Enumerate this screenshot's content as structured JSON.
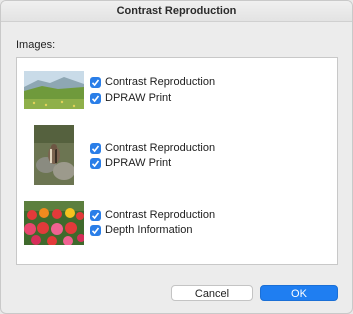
{
  "window": {
    "title": "Contrast Reproduction"
  },
  "images_label": "Images:",
  "images": [
    {
      "thumb_icon": "landscape-meadow-thumbnail",
      "options": [
        {
          "label": "Contrast Reproduction",
          "checked": true
        },
        {
          "label": "DPRAW Print",
          "checked": true
        }
      ]
    },
    {
      "thumb_icon": "chipmunk-on-rocks-thumbnail",
      "options": [
        {
          "label": "Contrast Reproduction",
          "checked": true
        },
        {
          "label": "DPRAW Print",
          "checked": true
        }
      ]
    },
    {
      "thumb_icon": "flower-bed-thumbnail",
      "options": [
        {
          "label": "Contrast Reproduction",
          "checked": true
        },
        {
          "label": "Depth Information",
          "checked": true
        }
      ]
    }
  ],
  "buttons": {
    "cancel": "Cancel",
    "ok": "OK"
  },
  "colors": {
    "accent": "#1f7ef1",
    "checkbox": "#2a7ee8"
  }
}
